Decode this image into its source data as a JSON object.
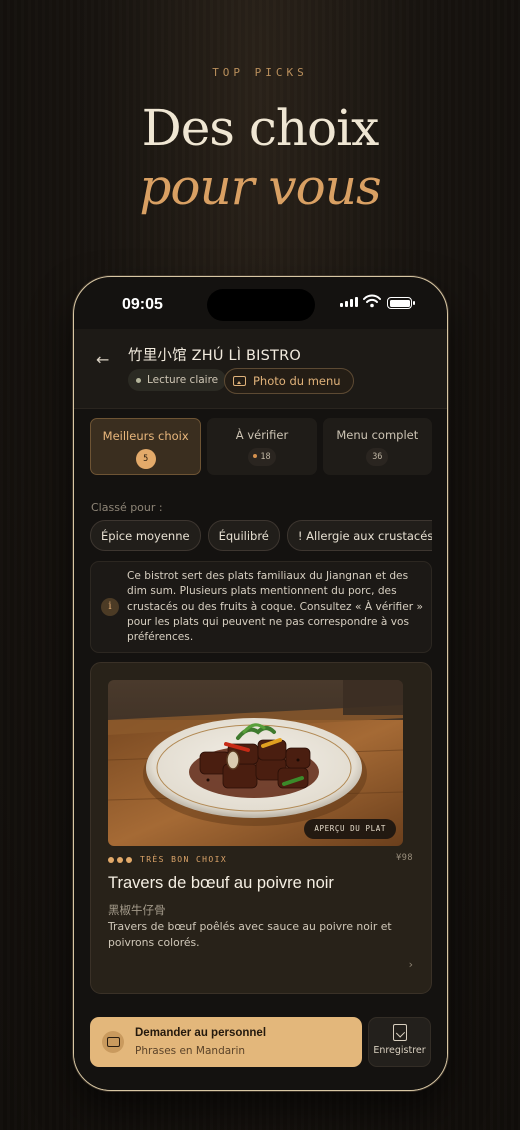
{
  "hero": {
    "eyebrow": "TOP PICKS",
    "title": "Des choix",
    "subtitle": "pour vous"
  },
  "status_bar": {
    "time": "09:05"
  },
  "header": {
    "restaurant_name": "竹里小馆 ZHÚ LÌ BISTRO",
    "reading_mode": "Lecture claire",
    "menu_photo": "Photo du menu"
  },
  "tabs": [
    {
      "label": "Meilleurs choix",
      "count": "5",
      "active": true
    },
    {
      "label": "À vérifier",
      "count": "18",
      "active": false
    },
    {
      "label": "Menu complet",
      "count": "36",
      "active": false
    }
  ],
  "ranked_for": {
    "label": "Classé pour :",
    "chips": [
      "Épice moyenne",
      "Équilibré",
      "! Allergie aux crustacés et coquillages"
    ]
  },
  "info": {
    "icon": "info-icon",
    "text": "Ce bistrot sert des plats familiaux du Jiangnan et des dim sum. Plusieurs plats mentionnent du porc, des crustacés ou des fruits à coque. Consultez « À vérifier » pour les plats qui peuvent ne pas correspondre à vos préférences."
  },
  "dish": {
    "preview_tag": "APERÇU DU PLAT",
    "rating": "TRÈS BON CHOIX",
    "price": "¥98",
    "name": "Travers de bœuf au poivre noir",
    "name_cn": "黑椒牛仔骨",
    "description": "Travers de bœuf poêlés avec sauce au poivre noir et poivrons colorés."
  },
  "bottom_bar": {
    "ask_title": "Demander au personnel",
    "ask_subtitle": "Phrases en Mandarin",
    "save_label": "Enregistrer"
  },
  "colors": {
    "accent": "#e3aa6a",
    "background": "#141210",
    "card": "#282219"
  }
}
